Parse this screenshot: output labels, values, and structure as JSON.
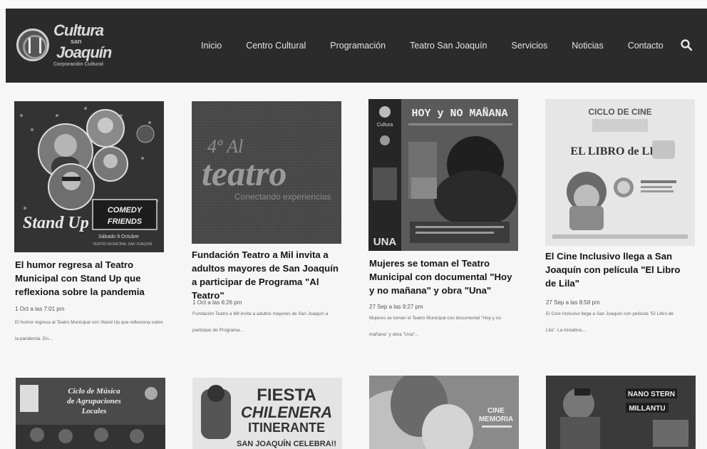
{
  "site": {
    "logo_lines": [
      "Cultura",
      "san",
      "Joaquín",
      "Corporación Cultural"
    ]
  },
  "nav": {
    "items": [
      "Inicio",
      "Centro Cultural",
      "Programación",
      "Teatro San Joaquín",
      "Servicios",
      "Noticias",
      "Contacto"
    ]
  },
  "posts": [
    {
      "title": "El humor regresa al Teatro Municipal con Stand Up que reflexiona sobre la pandemia",
      "date": "1 Oct a las 7:01 pm",
      "excerpt": "El humor regresa al Teatro Municipal con Stand Up que reflexiona sobre la pandemia. En...",
      "thumb_text": [
        "Stand Up",
        "Sábado 9 Octubre",
        "TEATRO MUNICIPAL SAN JOAQUÍN"
      ]
    },
    {
      "title": "Fundación Teatro a Mil invita a adultos mayores de San Joaquín a participar de Programa \"Al Teatro\"",
      "date": "1 Oct a las 6:26 pm",
      "excerpt": "Fundación Teatro a Mil invita a adultos mayores de San Joaquín a participar de Programa...",
      "thumb_text": [
        "4º Al",
        "teatro",
        "Conectando experiencias"
      ]
    },
    {
      "title": "Mujeres se toman el Teatro Municipal con documental \"Hoy y no mañana\" y obra \"Una\"",
      "date": "27 Sep a las 9:27 pm",
      "excerpt": "Mujeres se toman el Teatro Municipal con documental \"Hoy y no mañana\" y obra \"Una\"...",
      "thumb_text": [
        "HOY y NO MAÑANA",
        "UNA"
      ]
    },
    {
      "title": "El Cine Inclusivo llega a San Joaquín con película \"El Libro de Lila\"",
      "date": "27 Sep a las 8:58 pm",
      "excerpt": "El Cine Inclusivo llega a San Joaquín con película \"El Libro de Lila\". La iniciativa...",
      "thumb_text": [
        "CICLO DE CINE",
        "EL LIBRO de LILA"
      ]
    }
  ],
  "row2": [
    {
      "thumb_text": [
        "Ciclo de Música",
        "de Agrupaciones",
        "Locales"
      ]
    },
    {
      "thumb_text": [
        "FIESTA",
        "CHILENERA",
        "ITINERANTE",
        "SAN JOAQUÍN CELEBRA!!"
      ]
    },
    {
      "thumb_text": [
        "CINE",
        "MEMORIA"
      ]
    },
    {
      "thumb_text": [
        "NANO STERN",
        "MILLANTU"
      ]
    }
  ]
}
